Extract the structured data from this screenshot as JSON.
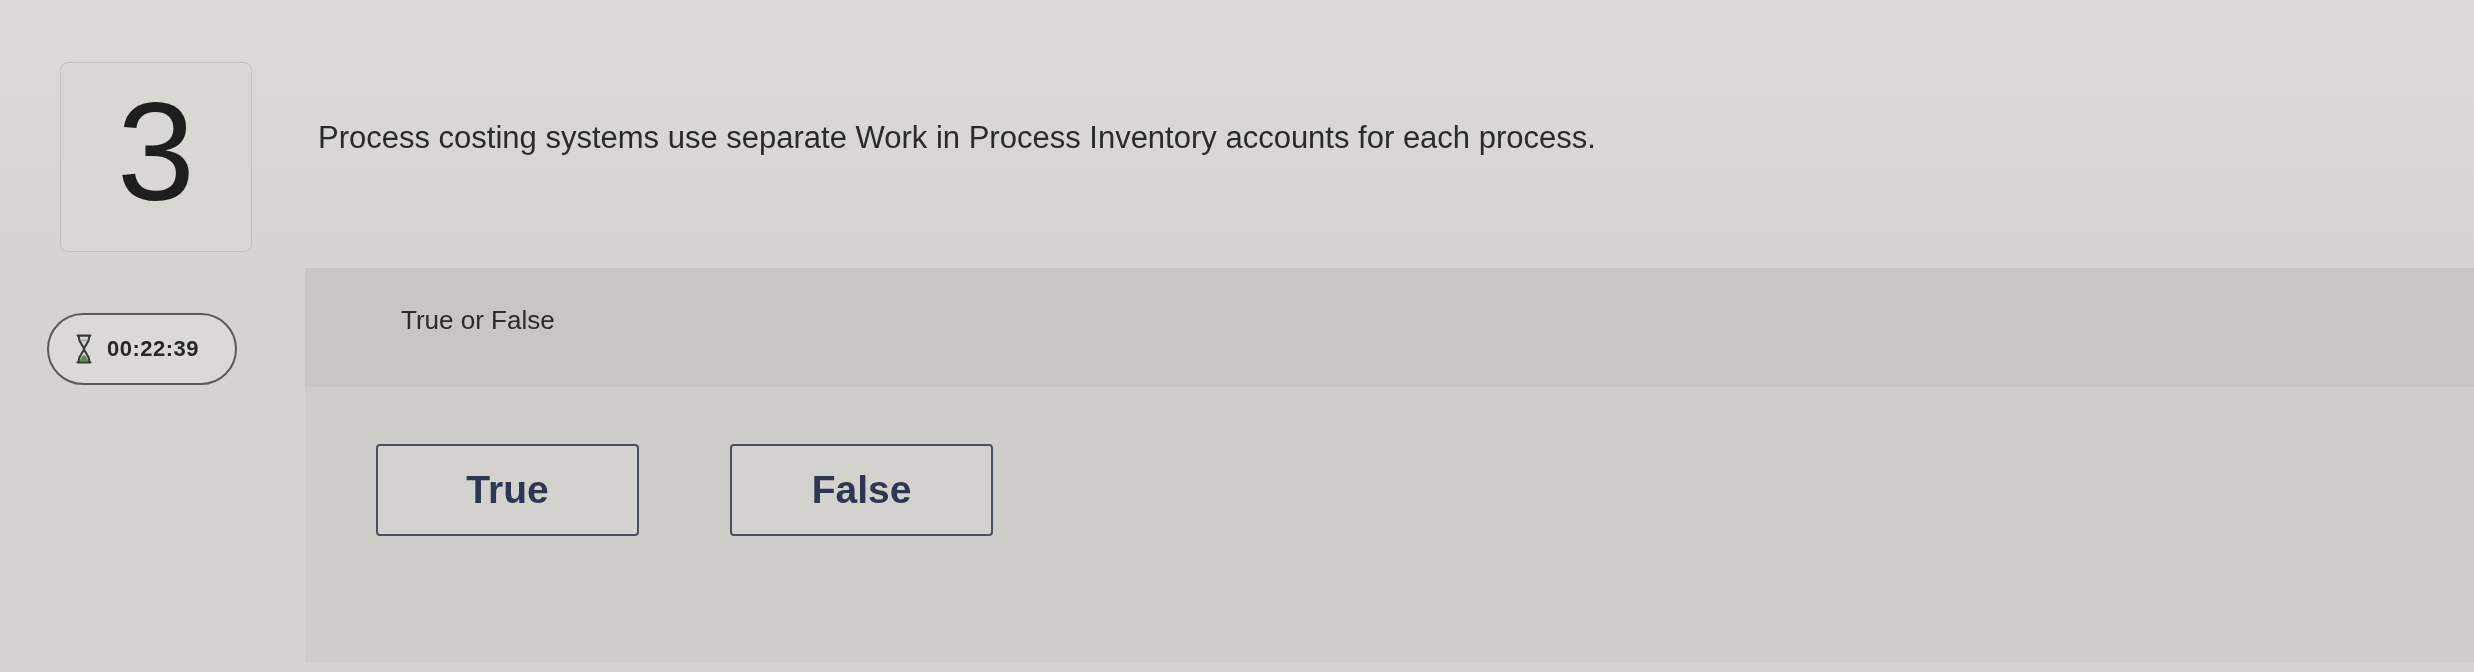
{
  "question": {
    "number": "3",
    "text": "Process costing systems use separate Work in Process Inventory accounts for each process."
  },
  "timer": {
    "time": "00:22:39"
  },
  "answer_panel": {
    "prompt": "True or False",
    "options": [
      {
        "label": "True",
        "selected": false
      },
      {
        "label": "False",
        "selected": false
      }
    ]
  }
}
